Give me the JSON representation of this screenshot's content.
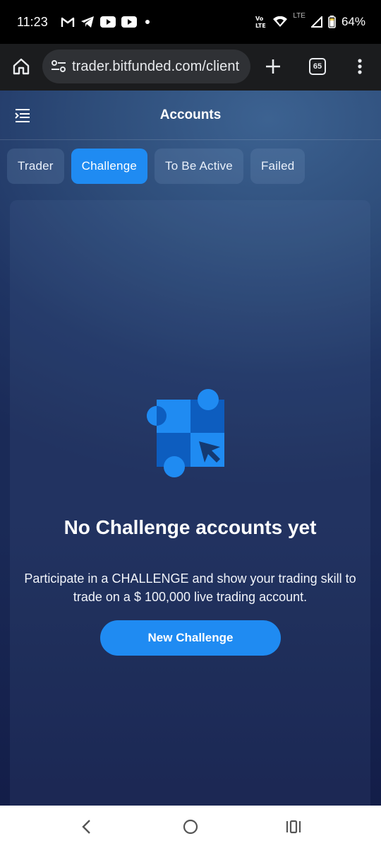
{
  "status_bar": {
    "time": "11:23",
    "battery": "64%",
    "network": "LTE",
    "icons_left": [
      "gmail-icon",
      "telegram-icon",
      "youtube-icon",
      "youtube-icon",
      "dot-icon"
    ],
    "icons_right": [
      "volte-icon",
      "wifi-icon",
      "signal-icon",
      "battery-icon"
    ]
  },
  "browser": {
    "url": "trader.bitfunded.com/client",
    "tab_count": "65"
  },
  "app": {
    "title": "Accounts",
    "tabs": [
      {
        "label": "Trader",
        "active": false
      },
      {
        "label": "Challenge",
        "active": true
      },
      {
        "label": "To Be Active",
        "active": false
      },
      {
        "label": "Failed",
        "active": false
      }
    ],
    "empty_state": {
      "title": "No Challenge accounts yet",
      "description": "Participate in a CHALLENGE and show your trading skill to trade on a $ 100,000 live trading account.",
      "button_label": "New Challenge"
    }
  },
  "colors": {
    "accent": "#1f8bf2",
    "background_top": "#3c6291",
    "background_bottom": "#1a2a57"
  }
}
